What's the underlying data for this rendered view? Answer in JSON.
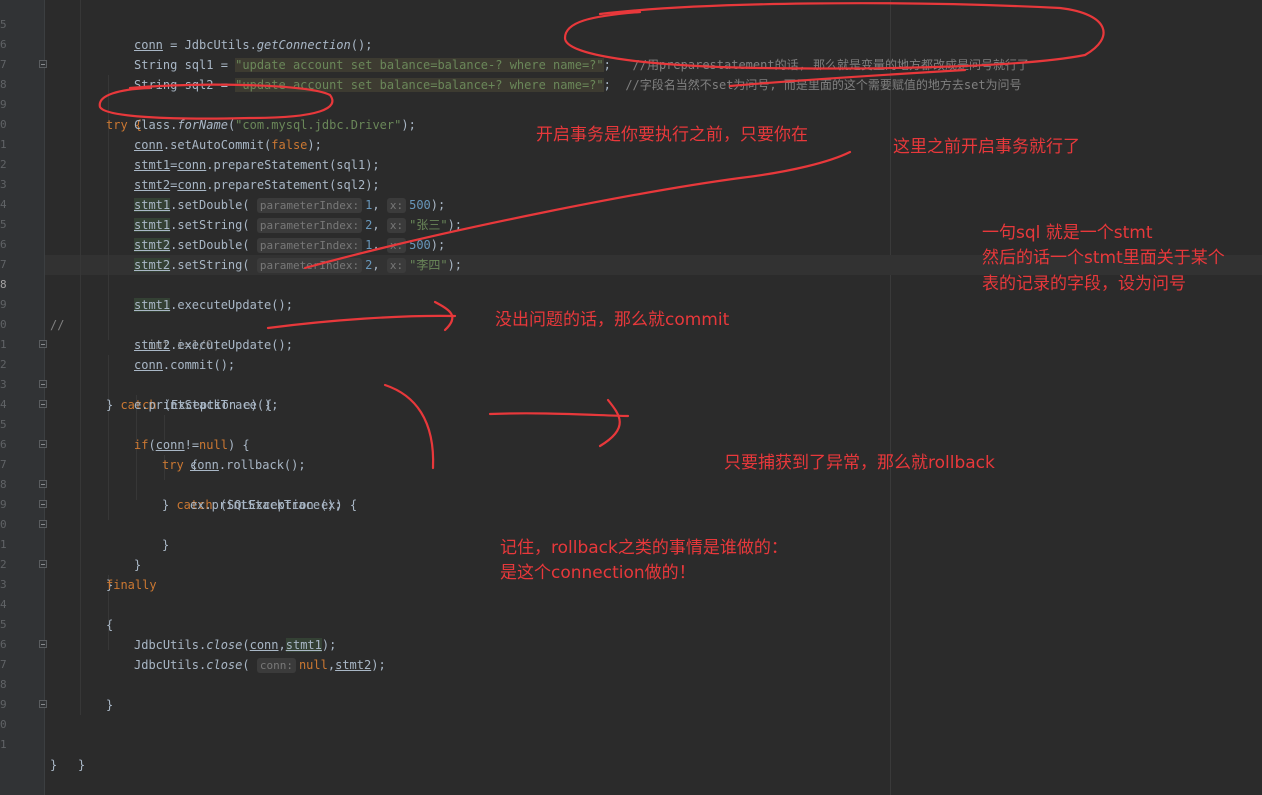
{
  "editor": {
    "line_numbers": [
      "5",
      "6",
      "7",
      "8",
      "9",
      "0",
      "1",
      "2",
      "3",
      "4",
      "5",
      "6",
      "7",
      "8",
      "9",
      "0",
      "1",
      "2",
      "3",
      "4",
      "5",
      "6",
      "7",
      "8",
      "9",
      "0",
      "1",
      "2",
      "3",
      "4",
      "5",
      "6",
      "7",
      "8",
      "9",
      "0",
      "1"
    ],
    "lines": {
      "l01_a": "conn",
      "l01_b": " = JdbcUtils.",
      "l01_c": "getConnection",
      "l01_d": "();",
      "l02_a": "String sql1 = ",
      "l02_b": "\"update account set balance=balance-? where name=?\"",
      "l02_c": ";   ",
      "l02_d": "//用preparestatement的话, 那么就是变量的地方都改成是问号就行了",
      "l03_a": "String sql2 = ",
      "l03_b": "\"update account set balance=balance+? where name=?\"",
      "l03_c": ";  ",
      "l03_d": "//字段名当然不set为问号, 而是里面的这个需要赋值的地方去set为问号",
      "l04": "try {",
      "l05_a": "Class.",
      "l05_b": "forName",
      "l05_c": "(",
      "l05_d": "\"com.mysql.jdbc.Driver\"",
      "l05_e": ");",
      "l06_a": "conn",
      "l06_b": ".setAutoCommit(",
      "l06_c": "false",
      "l06_d": ");",
      "l07_a": "stmt1",
      "l07_b": "=",
      "l07_c": "conn",
      "l07_d": ".prepareStatement(sql1);",
      "l08_a": "stmt2",
      "l08_b": "=",
      "l08_c": "conn",
      "l08_d": ".prepareStatement(sql2);",
      "l09_a": "stmt1",
      "l09_b": ".setDouble( ",
      "l09_hint1": "parameterIndex:",
      "l09_v1": "1",
      "l09_sep": ", ",
      "l09_hint2": "x:",
      "l09_v2": "500",
      "l09_end": ");",
      "l10_a": "stmt1",
      "l10_b": ".setString( ",
      "l10_hint1": "parameterIndex:",
      "l10_v1": "2",
      "l10_sep": ", ",
      "l10_hint2": "x:",
      "l10_v2": "\"张三\"",
      "l10_end": ");",
      "l11_a": "stmt2",
      "l11_b": ".setDouble( ",
      "l11_hint1": "parameterIndex:",
      "l11_v1": "1",
      "l11_sep": ", ",
      "l11_hint2": "x:",
      "l11_v2": "500",
      "l11_end": ");",
      "l12_a": "stmt2",
      "l12_b": ".setString( ",
      "l12_hint1": "parameterIndex:",
      "l12_v1": "2",
      "l12_sep": ", ",
      "l12_hint2": "x:",
      "l12_v2": "\"李四\"",
      "l12_end": ");",
      "l14_a": "stmt1",
      "l14_b": ".executeUpdate();",
      "l15_a": "//",
      "l15_b": "int i=1/0;",
      "l16_a": "stmt2",
      "l16_b": ".executeUpdate();",
      "l17_a": "conn",
      "l17_b": ".commit();",
      "l18_a": "} ",
      "l18_b": "catch",
      "l18_c": " (Exception e) {",
      "l19": "e.printStackTrace();",
      "l20_a": "if",
      "l20_b": "(",
      "l20_c": "conn",
      "l20_d": "!=",
      "l20_e": "null",
      "l20_f": ") {",
      "l21_a": "try",
      "l21_b": " {",
      "l22_a": "conn",
      "l22_b": ".rollback();",
      "l23_a": "} ",
      "l23_b": "catch",
      "l23_c": " (SQLException ex) {",
      "l24": "ex.printStackTrace();",
      "l25": "}",
      "l26": "}",
      "l27": "}",
      "l28": "finally",
      "l29": "{",
      "l31_a": "JdbcUtils.",
      "l31_b": "close",
      "l31_c": "(",
      "l31_d": "conn",
      "l31_e": ",",
      "l31_f": "stmt1",
      "l31_g": ");",
      "l32_a": "JdbcUtils.",
      "l32_b": "close",
      "l32_c": "( ",
      "l32_hint": "conn:",
      "l32_d": "null",
      "l32_e": ",",
      "l32_f": "stmt2",
      "l32_g": ");",
      "l33": "}",
      "l36": "}",
      "l37": "}"
    }
  },
  "annotations": {
    "note_transaction_start": "开启事务是你要执行之前，只要你在",
    "note_here_before": "这里之前开启事务就行了",
    "note_stmt_1": "一句sql 就是一个stmt",
    "note_stmt_2": "然后的话一个stmt里面关于某个",
    "note_stmt_3": "表的记录的字段，设为问号",
    "note_commit": "没出问题的话，那么就commit",
    "note_rollback": "只要捕获到了异常，那么就rollback",
    "note_who_1": "记住，rollback之类的事情是谁做的：",
    "note_who_2": "是这个connection做的！",
    "ink_color": "#e8383b"
  }
}
